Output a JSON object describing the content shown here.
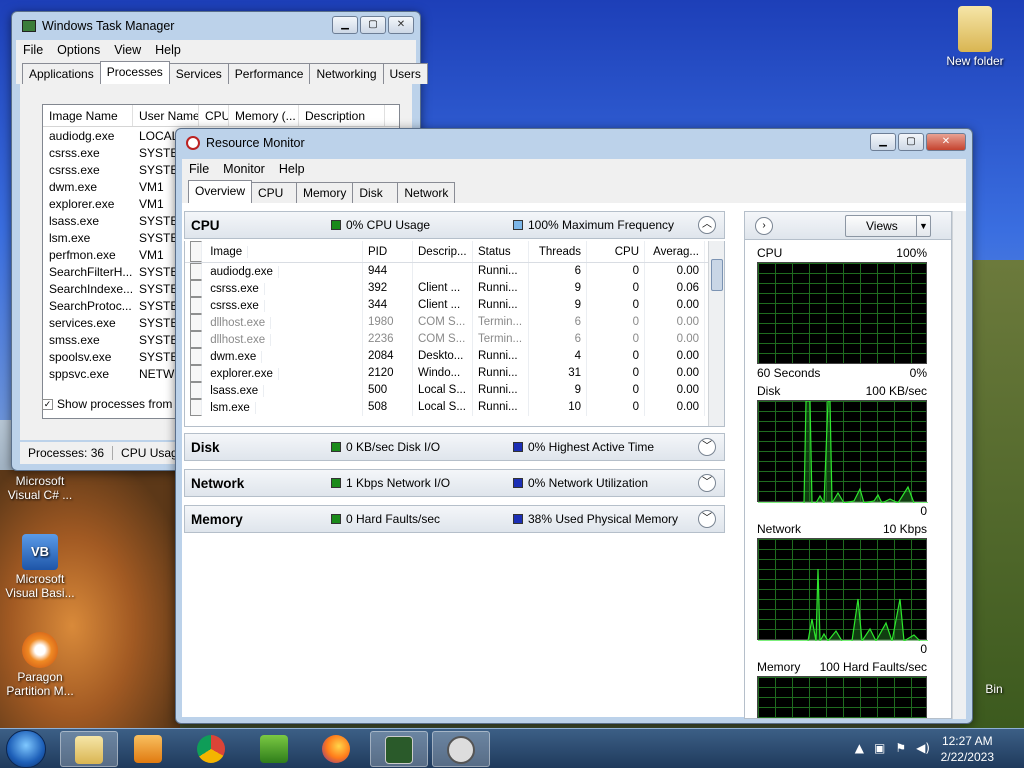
{
  "desktop": {
    "icons": [
      {
        "label": "New folder"
      },
      {
        "label": "Microsoft Visual C# ..."
      },
      {
        "label": "Microsoft Visual Basi..."
      },
      {
        "label": "Paragon Partition M..."
      },
      {
        "label": "Bin"
      }
    ]
  },
  "task_manager": {
    "title": "Windows Task Manager",
    "menu": [
      "File",
      "Options",
      "View",
      "Help"
    ],
    "tabs": [
      "Applications",
      "Processes",
      "Services",
      "Performance",
      "Networking",
      "Users"
    ],
    "columns": [
      "Image Name",
      "User Name",
      "CPU",
      "Memory (...",
      "Description"
    ],
    "rows": [
      [
        "audiodg.exe",
        "LOCAL"
      ],
      [
        "csrss.exe",
        "SYSTEM"
      ],
      [
        "csrss.exe",
        "SYSTEM"
      ],
      [
        "dwm.exe",
        "VM1"
      ],
      [
        "explorer.exe",
        "VM1"
      ],
      [
        "lsass.exe",
        "SYSTEM"
      ],
      [
        "lsm.exe",
        "SYSTEM"
      ],
      [
        "perfmon.exe",
        "VM1"
      ],
      [
        "SearchFilterH...",
        "SYSTEM"
      ],
      [
        "SearchIndexe...",
        "SYSTEM"
      ],
      [
        "SearchProtoc...",
        "SYSTEM"
      ],
      [
        "services.exe",
        "SYSTEM"
      ],
      [
        "smss.exe",
        "SYSTEM"
      ],
      [
        "spoolsv.exe",
        "SYSTEM"
      ],
      [
        "sppsvc.exe",
        "NETWO"
      ]
    ],
    "show_all_label": "Show processes from all",
    "status_processes": "Processes: 36",
    "status_cpu": "CPU Usag"
  },
  "resource_monitor": {
    "title": "Resource Monitor",
    "menu": [
      "File",
      "Monitor",
      "Help"
    ],
    "tabs": [
      "Overview",
      "CPU",
      "Memory",
      "Disk",
      "Network"
    ],
    "sections": {
      "cpu": {
        "name": "CPU",
        "m1": "0% CPU Usage",
        "m2": "100% Maximum Frequency"
      },
      "disk": {
        "name": "Disk",
        "m1": "0 KB/sec Disk I/O",
        "m2": "0% Highest Active Time"
      },
      "network": {
        "name": "Network",
        "m1": "1 Kbps Network I/O",
        "m2": "0% Network Utilization"
      },
      "memory": {
        "name": "Memory",
        "m1": "0 Hard Faults/sec",
        "m2": "38% Used Physical Memory"
      }
    },
    "cpu_columns": [
      "Image",
      "PID",
      "Descrip...",
      "Status",
      "Threads",
      "CPU",
      "Averag..."
    ],
    "cpu_rows": [
      {
        "image": "audiodg.exe",
        "pid": "944",
        "desc": "",
        "status": "Runni...",
        "threads": "6",
        "cpu": "0",
        "avg": "0.00",
        "grey": false
      },
      {
        "image": "csrss.exe",
        "pid": "392",
        "desc": "Client ...",
        "status": "Runni...",
        "threads": "9",
        "cpu": "0",
        "avg": "0.06",
        "grey": false
      },
      {
        "image": "csrss.exe",
        "pid": "344",
        "desc": "Client ...",
        "status": "Runni...",
        "threads": "9",
        "cpu": "0",
        "avg": "0.00",
        "grey": false
      },
      {
        "image": "dllhost.exe",
        "pid": "1980",
        "desc": "COM S...",
        "status": "Termin...",
        "threads": "6",
        "cpu": "0",
        "avg": "0.00",
        "grey": true
      },
      {
        "image": "dllhost.exe",
        "pid": "2236",
        "desc": "COM S...",
        "status": "Termin...",
        "threads": "6",
        "cpu": "0",
        "avg": "0.00",
        "grey": true
      },
      {
        "image": "dwm.exe",
        "pid": "2084",
        "desc": "Deskto...",
        "status": "Runni...",
        "threads": "4",
        "cpu": "0",
        "avg": "0.00",
        "grey": false
      },
      {
        "image": "explorer.exe",
        "pid": "2120",
        "desc": "Windo...",
        "status": "Runni...",
        "threads": "31",
        "cpu": "0",
        "avg": "0.00",
        "grey": false
      },
      {
        "image": "lsass.exe",
        "pid": "500",
        "desc": "Local S...",
        "status": "Runni...",
        "threads": "9",
        "cpu": "0",
        "avg": "0.00",
        "grey": false
      },
      {
        "image": "lsm.exe",
        "pid": "508",
        "desc": "Local S...",
        "status": "Runni...",
        "threads": "10",
        "cpu": "0",
        "avg": "0.00",
        "grey": false
      }
    ],
    "right_panel": {
      "views_label": "Views",
      "graphs": [
        {
          "name": "CPU",
          "max": "100%",
          "foot_left": "60 Seconds",
          "foot_right": "0%"
        },
        {
          "name": "Disk",
          "max": "100 KB/sec",
          "foot_left": "",
          "foot_right": "0"
        },
        {
          "name": "Network",
          "max": "10 Kbps",
          "foot_left": "",
          "foot_right": "0"
        },
        {
          "name": "Memory",
          "max": "100 Hard Faults/sec",
          "foot_left": "",
          "foot_right": ""
        }
      ]
    }
  },
  "taskbar": {
    "time": "12:27 AM",
    "date": "2/22/2023"
  },
  "colors": {
    "graph_line": "#2ee62e",
    "graph_grid": "#1f6b1f"
  }
}
